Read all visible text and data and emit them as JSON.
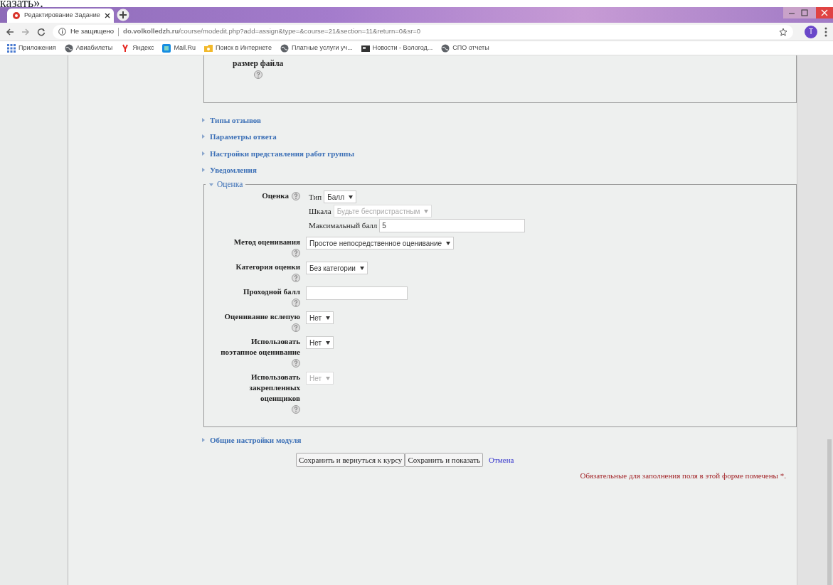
{
  "fragment_text": "казать».",
  "browser": {
    "tab_title": "Редактирование Задание",
    "security_label": "Не защищено",
    "url": "**do.volkolledzh.ru**/course/modedit.php?add=assign&type=&course=21&section=11&return=0&sr=0",
    "avatar_letter": "Т",
    "bookmarks": [
      {
        "kind": "apps",
        "label": "Приложения"
      },
      {
        "kind": "globe",
        "label": "Авиабилеты"
      },
      {
        "kind": "yandex",
        "label": "Яндекс"
      },
      {
        "kind": "mail",
        "label": "Mail.Ru"
      },
      {
        "kind": "search",
        "label": "Поиск в Интернете"
      },
      {
        "kind": "globe",
        "label": "Платные услуги уч..."
      },
      {
        "kind": "news",
        "label": "Новости - Вологод..."
      },
      {
        "kind": "globe",
        "label": "СПО отчеты"
      }
    ]
  },
  "previous_field_label": "размер файла",
  "sections": [
    {
      "title": "Типы отзывов",
      "expanded": false
    },
    {
      "title": "Параметры ответа",
      "expanded": false
    },
    {
      "title": "Настройки представления работ группы",
      "expanded": false
    },
    {
      "title": "Уведомления",
      "expanded": false
    },
    {
      "title": "Оценка",
      "expanded": true,
      "grade": {
        "label": "Оценка",
        "subfields": [
          {
            "kind": "select",
            "label": "Тип",
            "value": "Балл",
            "disabled": false
          },
          {
            "kind": "select",
            "label": "Шкала",
            "value": "Будьте беспристрастным",
            "disabled": true
          },
          {
            "kind": "input",
            "label": "Максимальный балл",
            "value": "5",
            "disabled": false
          }
        ]
      },
      "fields": [
        {
          "kind": "select",
          "label": "Метод оценивания",
          "value": "Простое непосредственное оценивание",
          "disabled": false
        },
        {
          "kind": "select",
          "label": "Категория оценки",
          "value": "Без категории",
          "disabled": false
        },
        {
          "kind": "input",
          "label": "Проходной балл",
          "disabled": false
        },
        {
          "kind": "select",
          "label": "Оценивание вслепую",
          "value": "Нет",
          "disabled": false
        },
        {
          "kind": "select",
          "label": "Использовать поэтапное оценивание",
          "value": "Нет",
          "disabled": false
        },
        {
          "kind": "select",
          "label": "Использовать закрепленных оценщиков",
          "value": "Нет",
          "disabled": true
        }
      ]
    },
    {
      "title": "Общие настройки модуля",
      "expanded": false
    }
  ],
  "buttons": [
    "Сохранить и вернуться к курсу",
    "Сохранить и показать"
  ],
  "cancel_link": "Отмена",
  "required_note": "Обязательные для заполнения поля в этой форме помечены *."
}
